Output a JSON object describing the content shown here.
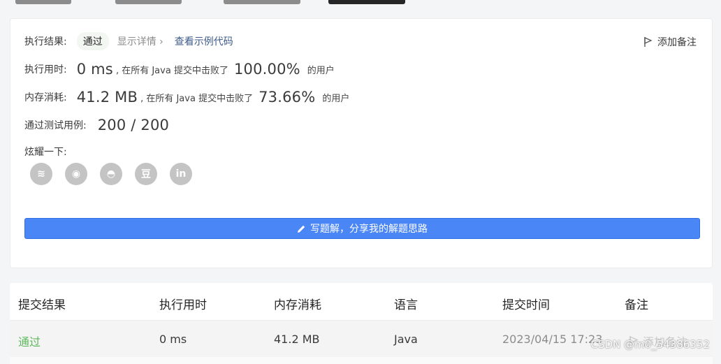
{
  "result": {
    "label": "执行结果:",
    "status": "通过",
    "details_link": "显示详情",
    "details_chevron": "›",
    "example_link": "查看示例代码",
    "add_note": "添加备注"
  },
  "runtime": {
    "label": "执行用时:",
    "value": "0 ms",
    "text": ", 在所有 Java 提交中击败了",
    "percent": "100.00%",
    "suffix": "的用户"
  },
  "memory": {
    "label": "内存消耗:",
    "value": "41.2 MB",
    "text": ", 在所有 Java 提交中击败了",
    "percent": "73.66%",
    "suffix": "的用户"
  },
  "tests": {
    "label": "通过测试用例:",
    "value": "200 / 200"
  },
  "share": {
    "label": "炫耀一下:",
    "icons": [
      "wechat-icon",
      "weibo-icon",
      "qq-icon",
      "douban-icon",
      "linkedin-icon"
    ],
    "glyphs": [
      "≋",
      "◉",
      "◓",
      "豆",
      "in"
    ]
  },
  "solution_button": "写题解，分享我的解题思路",
  "table": {
    "headers": [
      "提交结果",
      "执行用时",
      "内存消耗",
      "语言",
      "提交时间",
      "备注"
    ],
    "rows": [
      [
        "通过",
        "0 ms",
        "41.2 MB",
        "Java",
        "2023/04/15 17:23",
        "添加备注"
      ]
    ]
  },
  "watermark": "CSDN @m0_54386352",
  "colors": {
    "accent": "#4a86f5",
    "pass": "#5cb85c",
    "link": "#3d5a8a"
  }
}
